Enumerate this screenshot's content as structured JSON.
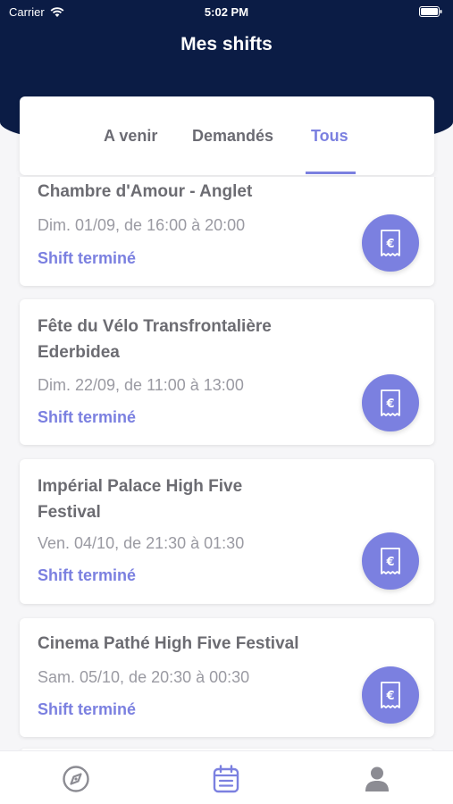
{
  "status_bar": {
    "carrier": "Carrier",
    "time": "5:02 PM"
  },
  "header": {
    "title": "Mes shifts"
  },
  "tabs": [
    {
      "label": "A venir",
      "active": false
    },
    {
      "label": "Demandés",
      "active": false
    },
    {
      "label": "Tous",
      "active": true
    }
  ],
  "shifts": [
    {
      "title": "Chambre d'Amour - Anglet",
      "time": "Dim. 01/09, de 16:00 à 20:00",
      "status": "Shift terminé",
      "icon": "invoice-euro-icon"
    },
    {
      "title": "Fête du Vélo Transfrontalière Ederbidea",
      "time": "Dim. 22/09, de 11:00 à 13:00",
      "status": "Shift terminé",
      "icon": "invoice-euro-icon"
    },
    {
      "title": "Impérial Palace High Five Festival",
      "time": "Ven. 04/10, de 21:30 à 01:30",
      "status": "Shift terminé",
      "icon": "invoice-euro-icon"
    },
    {
      "title": "Cinema Pathé High Five Festival",
      "time": "Sam. 05/10, de 20:30 à 00:30",
      "status": "Shift terminé",
      "icon": "invoice-euro-icon"
    }
  ],
  "bottom_nav": [
    {
      "icon": "compass-icon",
      "active": false
    },
    {
      "icon": "calendar-icon",
      "active": true
    },
    {
      "icon": "user-icon",
      "active": false
    }
  ],
  "colors": {
    "header_bg": "#0b1c45",
    "accent": "#7b80e0",
    "text": "#6c6c72",
    "muted": "#9a9aa2"
  }
}
